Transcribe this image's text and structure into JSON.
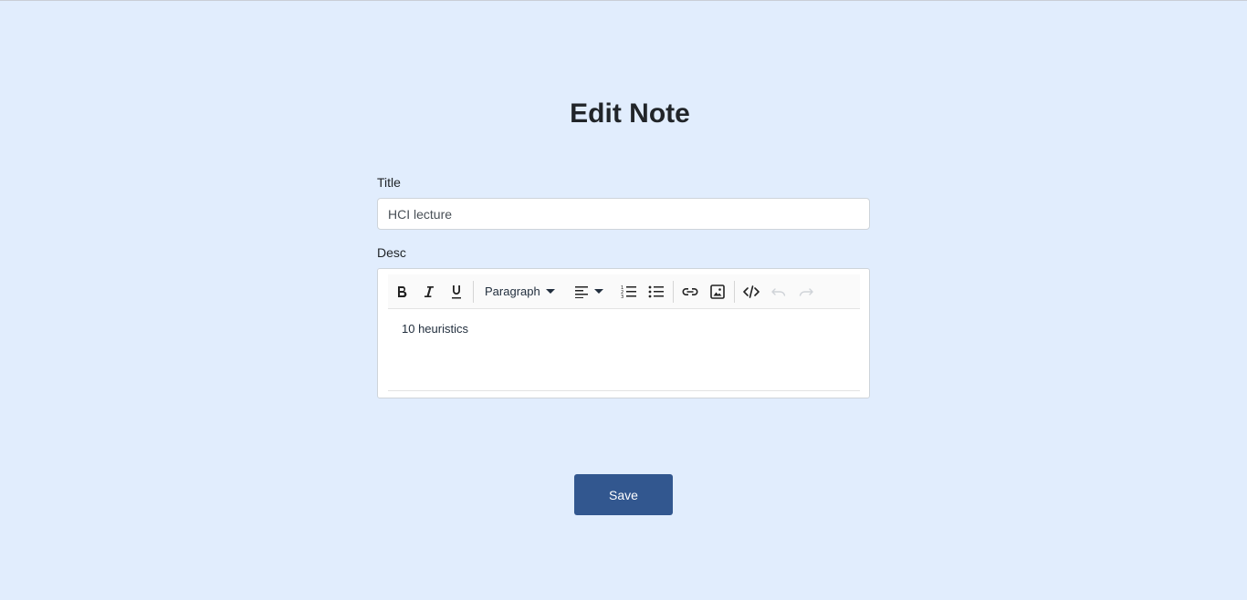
{
  "page": {
    "title": "Edit Note"
  },
  "form": {
    "title_label": "Title",
    "title_value": "HCI lecture",
    "desc_label": "Desc"
  },
  "editor": {
    "toolbar": {
      "bold_icon": "bold-icon",
      "italic_icon": "italic-icon",
      "underline_icon": "underline-icon",
      "block_format": "Paragraph",
      "align_icon": "align-left-icon",
      "ordered_list_icon": "numbered-list-icon",
      "bullet_list_icon": "bullet-list-icon",
      "link_icon": "link-icon",
      "image_icon": "image-icon",
      "code_icon": "code-icon",
      "undo_icon": "undo-icon",
      "redo_icon": "redo-icon"
    },
    "content": "10 heuristics"
  },
  "actions": {
    "save_label": "Save"
  },
  "colors": {
    "background": "#e1edfd",
    "accent": "#32578f"
  }
}
